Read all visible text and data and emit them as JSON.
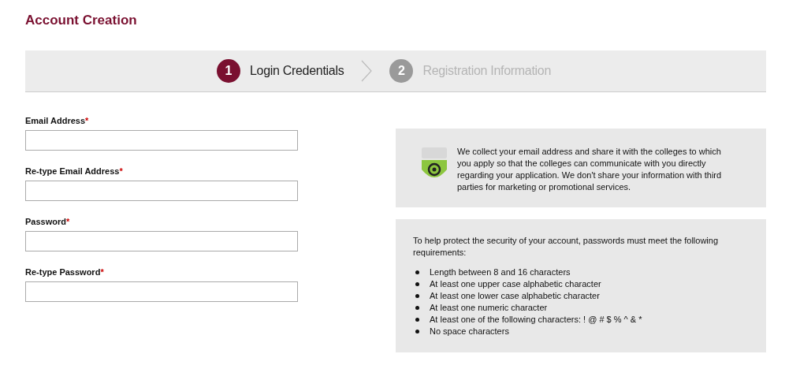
{
  "page_title": "Account Creation",
  "steps": [
    {
      "number": "1",
      "label": "Login Credentials",
      "selected": true
    },
    {
      "number": "2",
      "label": "Registration Information",
      "selected": false
    }
  ],
  "fields": [
    {
      "label": "Email Address",
      "required": "*"
    },
    {
      "label": "Re-type Email Address",
      "required": "*"
    },
    {
      "label": "Password",
      "required": "*"
    },
    {
      "label": "Re-type Password",
      "required": "*"
    }
  ],
  "privacy_note": "We collect your email address and share it with the colleges to which you apply so that the colleges can communicate with you directly regarding your application. We don't share your information with third parties for marketing or promotional services.",
  "password_rules": {
    "intro": "To help protect the security of your account, passwords must meet the following requirements:",
    "items": [
      "Length between 8 and 16 characters",
      "At least one upper case alphabetic character",
      "At least one lower case alphabetic character",
      "At least one numeric character",
      "At least one of the following characters: ! @ # $ % ^ & *",
      "No space characters"
    ]
  }
}
